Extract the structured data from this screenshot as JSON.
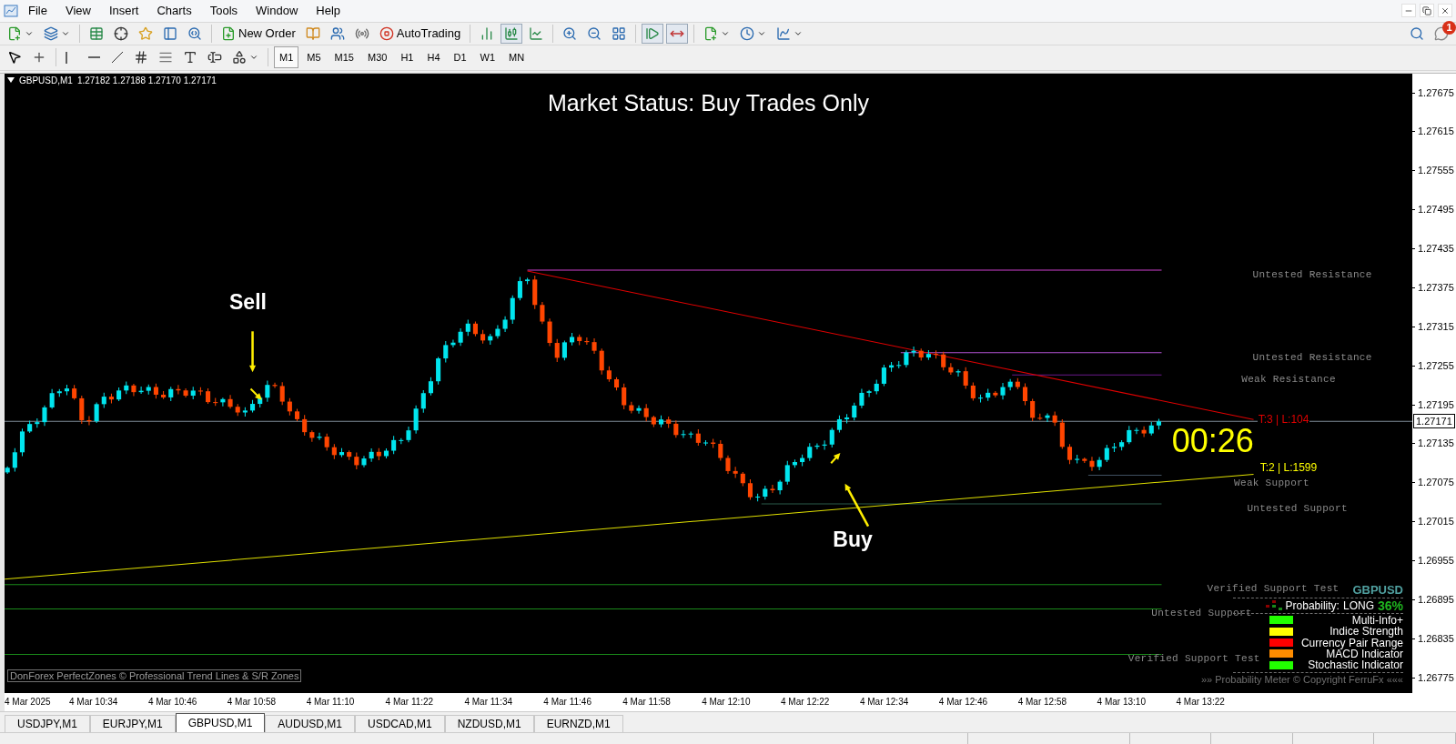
{
  "menu": [
    "File",
    "View",
    "Insert",
    "Charts",
    "Tools",
    "Window",
    "Help"
  ],
  "toolbar": {
    "new_order": "New Order",
    "auto_trading": "AutoTrading",
    "notification_count": "1"
  },
  "chart_types": [
    {
      "kind": "bars",
      "selected": false
    },
    {
      "kind": "candles",
      "selected": true
    },
    {
      "kind": "line",
      "selected": false
    }
  ],
  "toggles": {
    "auto_scroll": true,
    "chart_shift": true
  },
  "timeframes": [
    {
      "label": "M1",
      "selected": true
    },
    {
      "label": "M5",
      "selected": false
    },
    {
      "label": "M15",
      "selected": false
    },
    {
      "label": "M30",
      "selected": false
    },
    {
      "label": "H1",
      "selected": false
    },
    {
      "label": "H4",
      "selected": false
    },
    {
      "label": "D1",
      "selected": false
    },
    {
      "label": "W1",
      "selected": false
    },
    {
      "label": "MN",
      "selected": false
    }
  ],
  "chart": {
    "symbol": "GBPUSD,M1",
    "quotes": "1.27182 1.27188 1.27170 1.27171",
    "market_status": "Market Status: Buy Trades Only",
    "signals": [
      {
        "kind": "sell",
        "label": "Sell"
      },
      {
        "kind": "buy",
        "label": "Buy"
      }
    ],
    "zones": [
      "Untested Resistance",
      "Untested Resistance",
      "Weak Resistance",
      "Weak Support",
      "Untested Support",
      "Verified Support Test",
      "Untested Support",
      "Verified Support Test"
    ],
    "trend_labels": [
      {
        "label": "T:3 | L:104",
        "color": "#e00000"
      },
      {
        "label": "T:2 | L:1599",
        "color": "#ffff00"
      }
    ],
    "timer": "00:26",
    "current_price": "1.27171",
    "price_axis": [
      "1.27675",
      "1.27615",
      "1.27555",
      "1.27495",
      "1.27435",
      "1.27375",
      "1.27315",
      "1.27255",
      "1.27195",
      "1.27135",
      "1.27075",
      "1.27015",
      "1.26955",
      "1.26895",
      "1.26835",
      "1.26775"
    ],
    "time_axis": [
      "4 Mar 2025",
      "4 Mar 10:34",
      "4 Mar 10:46",
      "4 Mar 10:58",
      "4 Mar 11:10",
      "4 Mar 11:22",
      "4 Mar 11:34",
      "4 Mar 11:46",
      "4 Mar 11:58",
      "4 Mar 12:10",
      "4 Mar 12:22",
      "4 Mar 12:34",
      "4 Mar 12:46",
      "4 Mar 12:58",
      "4 Mar 13:10",
      "4 Mar 13:22"
    ],
    "credit": "DonForex PerfectZones © Professional Trend Lines & S/R Zones",
    "probability_meter": {
      "symbol": "GBPUSD",
      "label": "Probability:",
      "direction": "LONG",
      "percent": "36%",
      "indicators": [
        {
          "name": "Multi-Info+",
          "color": "#22ff00"
        },
        {
          "name": "Indice Strength",
          "color": "#ffff00"
        },
        {
          "name": "Currency Pair Range",
          "color": "#ff0000"
        },
        {
          "name": "MACD Indicator",
          "color": "#ff8c00"
        },
        {
          "name": "Stochastic Indicator",
          "color": "#22ff00"
        }
      ],
      "footer": "»» Probability Meter © Copyright FerruFx «««"
    }
  },
  "tabs": [
    {
      "label": "USDJPY,M1",
      "selected": false
    },
    {
      "label": "EURJPY,M1",
      "selected": false
    },
    {
      "label": "GBPUSD,M1",
      "selected": true
    },
    {
      "label": "AUDUSD,M1",
      "selected": false
    },
    {
      "label": "USDCAD,M1",
      "selected": false
    },
    {
      "label": "NZDUSD,M1",
      "selected": false
    },
    {
      "label": "EURNZD,M1",
      "selected": false
    }
  ]
}
